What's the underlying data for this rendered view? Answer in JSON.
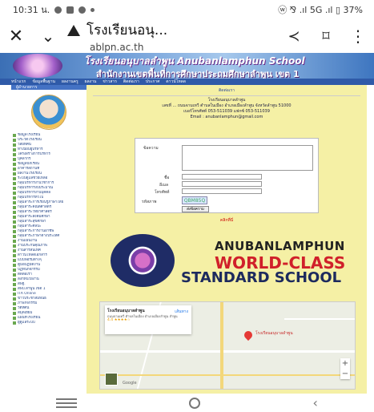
{
  "statusbar": {
    "time": "10:31 น.",
    "right": "ⓦ ⅋ .ıl 5G .ıl ▯ 37%"
  },
  "toolbar": {
    "title": "โรงเรียนอนุ...",
    "url": "ablpn.ac.th"
  },
  "page": {
    "banner_title": "โรงเรียนอนุบาลลำพูน  Anubanlamphun School",
    "banner_subtitle": "สำนักงานเขตพื้นที่การศึกษาประถมศึกษาลำพูน เขต 1",
    "menu": [
      "หน้าแรก",
      "ข้อมูลพื้นฐาน",
      "ผลงานครู",
      "ผลงาน",
      "ข่าวสาร",
      "ติดต่อเรา",
      "ประกาศ",
      "ดาวน์โหลด"
    ],
    "contact_header": "ติดต่อเรา",
    "contact_lines": [
      "โรงเรียนอนุบาลลำพูน",
      "เลขที่ ... ถนนจามเทวี ตำบลในเมือง อำเภอเมืองลำพูน จังหวัดลำพูน 51000",
      "เบอร์โทรศัพท์ 053-511039 แฟกซ์ 053-511039",
      "Email : anubanlamphun@gmail.com"
    ],
    "form_labels": {
      "message": "ข้อความ",
      "name": "ชื่อ",
      "email": "อีเมล",
      "phone": "โทรศัพท์",
      "code": "รหัสภาพ"
    },
    "captcha": "QBM85Q",
    "submit": "ส่งข้อความ",
    "form_link": "คลิกที่นี่",
    "wc_line1": "ANUBANLAMPHUN",
    "wc_line2": "WORLD-CLASS",
    "wc_line3": "STANDARD SCHOOL",
    "map": {
      "place": "โรงเรียนอนุบาลลำพูน",
      "address": "ถนนจามเทวี ตำบลในเมือง อำเภอเมืองลำพูน ลำพูน",
      "rating": "4.4 ★★★★☆",
      "directions": "เส้นทาง",
      "pin_label": "โรงเรียนอนุบาลลำพูน",
      "brand": "Google"
    }
  },
  "sidebar": {
    "director_name": "ผู้อำนวยการ",
    "items": [
      "ข้อมูลโรงเรียน",
      "ประวัติโรงเรียน",
      "วิสัยทัศน์",
      "ทำเนียบผู้บริหาร",
      "โครงสร้างการบริหาร",
      "บุคลากร",
      "ข้อมูลนักเรียน",
      "อาคารสถานที่",
      "ผลงานโรงเรียน",
      "ระบบดูแลช่วยเหลือ",
      "กลุ่มบริหารงานวิชาการ",
      "กลุ่มบริหารงบประมาณ",
      "กลุ่มบริหารงานบุคคล",
      "กลุ่มบริหารทั่วไป",
      "กลุ่มสาระการเรียนรู้ภาษาไทย",
      "กลุ่มสาระคณิตศาสตร์",
      "กลุ่มสาระวิทยาศาสตร์",
      "กลุ่มสาระสังคมศึกษา",
      "กลุ่มสาระสุขศึกษา",
      "กลุ่มสาระศิลปะ",
      "กลุ่มสาระการงานอาชีพ",
      "กลุ่มสาระภาษาต่างประเทศ",
      "งานแผนงาน",
      "งานประกันคุณภาพ",
      "งานสารสนเทศ",
      "ดาวน์โหลดเอกสาร",
      "แบบฟอร์มต่างๆ",
      "คู่มือปฏิบัติงาน",
      "ปฏิทินกิจกรรม",
      "ติดต่อเรา",
      "ลิงก์หน่วยงาน",
      "สพฐ.",
      "สพป.ลำพูน เขต 1",
      "ITA Online",
      "ข่าวประชาสัมพันธ์",
      "ภาพกิจกรรม",
      "วีดีทัศน์",
      "สมุดเยี่ยม",
      "แผนที่โรงเรียน",
      "ผู้ดูแลระบบ"
    ]
  },
  "colors": {
    "yellow": "#f5f0a5",
    "blue": "#2f5aa8",
    "red": "#d0202a"
  }
}
